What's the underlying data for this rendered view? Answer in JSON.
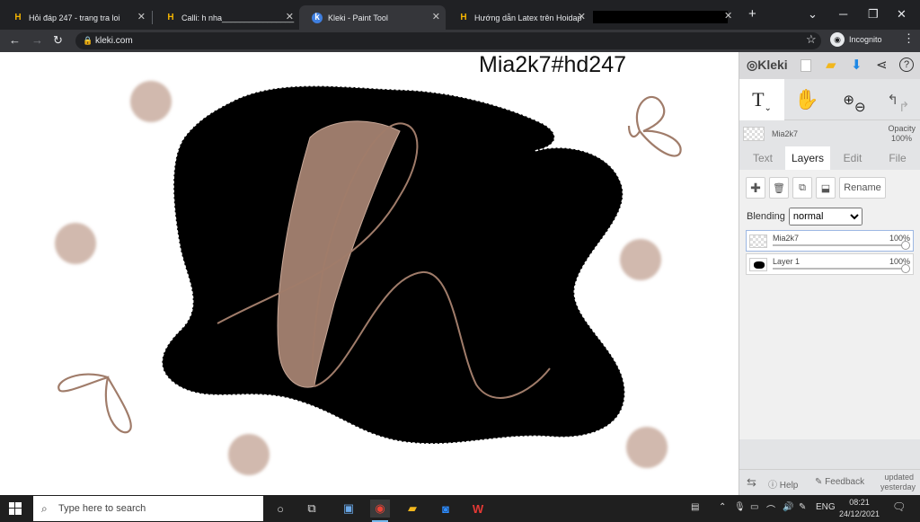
{
  "browser": {
    "tabs": [
      {
        "title": "Hỏi đáp 247 - trang tra loi",
        "favicon": "H"
      },
      {
        "title": "Calli: h nha________________",
        "favicon": "H"
      },
      {
        "title": "Kleki - Paint Tool",
        "favicon": "K"
      },
      {
        "title": "Hướng dẫn Latex trên Hoidap",
        "favicon": "H"
      }
    ],
    "new_tab": "+",
    "url": "kleki.com",
    "profile_label": "Incognito"
  },
  "canvas": {
    "text_layer": "Mia2k7#hd247",
    "colors": {
      "blob": "#000000",
      "accent": "#9c7b6b",
      "dot": "#d1b9ae",
      "stroke": "#a07c6a"
    }
  },
  "panel": {
    "logo": "Kleki",
    "tool_text": "T",
    "brush_name": "Mia2k7",
    "opacity_label": "Opacity",
    "opacity_value": "100%",
    "tabs": [
      "Text",
      "Layers",
      "Edit",
      "File"
    ],
    "active_tab": "Layers",
    "rename_label": "Rename",
    "blending_label": "Blending",
    "blending_value": "normal",
    "layers": [
      {
        "name": "Mia2k7",
        "opacity": "100%",
        "selected": true
      },
      {
        "name": "Layer 1",
        "opacity": "100%",
        "selected": false
      }
    ],
    "help_label": "Help",
    "feedback_label": "Feedback",
    "updated_label": "updated",
    "updated_when": "yesterday"
  },
  "taskbar": {
    "search_placeholder": "Type here to search",
    "language": "ENG",
    "time": "08:21",
    "date": "24/12/2021"
  }
}
